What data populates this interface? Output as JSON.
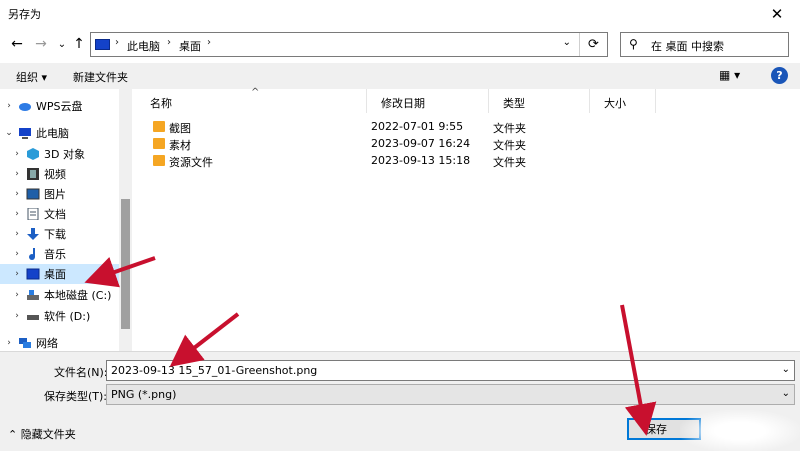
{
  "window": {
    "title": "另存为",
    "close_glyph": "✕"
  },
  "nav": {
    "back": "←",
    "forward": "→",
    "recent": "⌄",
    "up": "↑",
    "breadcrumb": [
      "此电脑",
      "桌面"
    ],
    "separator": "›",
    "dropdown": "⌄",
    "refresh": "⟳",
    "search_placeholder": "在 桌面 中搜索"
  },
  "toolbar": {
    "organize": "组织 ▾",
    "new_folder": "新建文件夹",
    "view": "▦ ▾",
    "help": "?"
  },
  "tree": {
    "items": [
      {
        "label": "WPS云盘",
        "expander": "›"
      },
      {
        "label": "此电脑",
        "expander": "⌄"
      },
      {
        "label": "3D 对象",
        "expander": "›"
      },
      {
        "label": "视频",
        "expander": "›"
      },
      {
        "label": "图片",
        "expander": "›"
      },
      {
        "label": "文档",
        "expander": "›"
      },
      {
        "label": "下载",
        "expander": "›"
      },
      {
        "label": "音乐",
        "expander": "›"
      },
      {
        "label": "桌面",
        "expander": "›"
      },
      {
        "label": "本地磁盘 (C:)",
        "expander": "›"
      },
      {
        "label": "软件 (D:)",
        "expander": "›"
      },
      {
        "label": "网络",
        "expander": "›"
      }
    ]
  },
  "list": {
    "columns": [
      "名称",
      "修改日期",
      "类型",
      "大小"
    ],
    "sort_indicator": "^",
    "rows": [
      {
        "name": "截图",
        "date": "2022-07-01 9:55",
        "type": "文件夹"
      },
      {
        "name": "素材",
        "date": "2023-09-07 16:24",
        "type": "文件夹"
      },
      {
        "name": "资源文件",
        "date": "2023-09-13 15:18",
        "type": "文件夹"
      }
    ]
  },
  "bottom": {
    "filename_label": "文件名(N):",
    "filename_value": "2023-09-13 15_57_01-Greenshot.png",
    "filetype_label": "保存类型(T):",
    "filetype_value": "PNG (*.png)",
    "hide_folders": "⌃ 隐藏文件夹",
    "save": "保存",
    "dropdown": "⌄"
  },
  "colors": {
    "accent": "#0078d7",
    "selection": "#cce8ff",
    "folder": "#f5a623",
    "arrow": "#c8102e"
  }
}
